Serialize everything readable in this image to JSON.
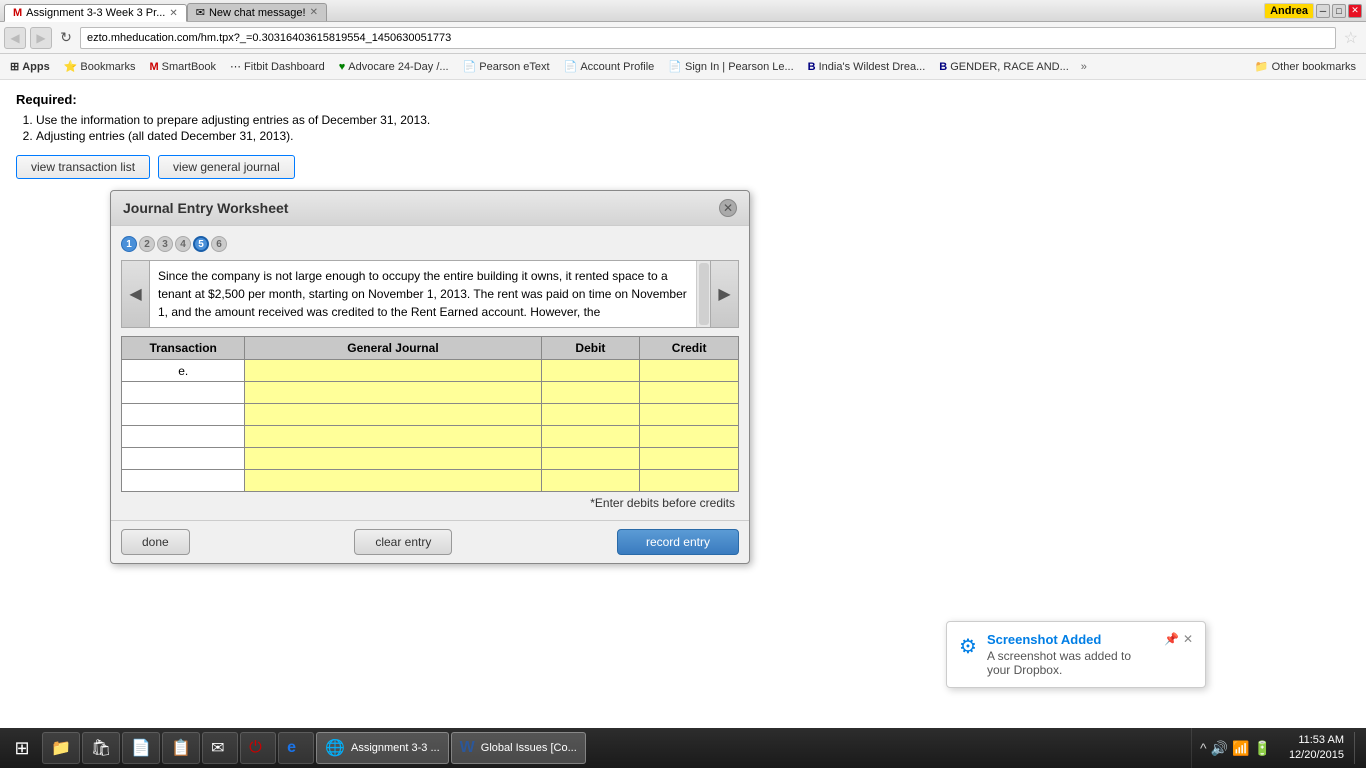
{
  "titlebar": {
    "tabs": [
      {
        "id": "tab1",
        "label": "Assignment 3-3 Week 3 Pr...",
        "favicon": "M",
        "active": true
      },
      {
        "id": "tab2",
        "label": "New chat message!",
        "favicon": "✉",
        "active": false
      }
    ],
    "controls": {
      "minimize": "─",
      "maximize": "□",
      "close": "✕"
    },
    "user": "Andrea"
  },
  "addressbar": {
    "url": "ezto.mheducation.com/hm.tpx?_=0.30316403615819554_1450630051773",
    "back_disabled": true,
    "forward_disabled": true
  },
  "bookmarks": {
    "items": [
      {
        "id": "apps",
        "label": "Apps",
        "type": "apps"
      },
      {
        "id": "bookmarks",
        "label": "Bookmarks",
        "type": "folder"
      },
      {
        "id": "smartbook",
        "label": "SmartBook",
        "type": "link"
      },
      {
        "id": "fitbit",
        "label": "Fitbit Dashboard",
        "type": "link"
      },
      {
        "id": "advocare",
        "label": "Advocare 24-Day /...",
        "type": "link"
      },
      {
        "id": "pearson",
        "label": "Pearson eText",
        "type": "link"
      },
      {
        "id": "account",
        "label": "Account Profile",
        "type": "link"
      },
      {
        "id": "signin",
        "label": "Sign In | Pearson Le...",
        "type": "link"
      },
      {
        "id": "india",
        "label": "India's Wildest Drea...",
        "type": "link"
      },
      {
        "id": "gender",
        "label": "GENDER, RACE AND...",
        "type": "link"
      },
      {
        "id": "more",
        "label": "»",
        "type": "more"
      },
      {
        "id": "otherbookmarks",
        "label": "Other bookmarks",
        "type": "folder"
      }
    ]
  },
  "page": {
    "required_label": "Required:",
    "instruction1": "Use the information to prepare adjusting entries as of December 31, 2013.",
    "instruction2": "Adjusting entries (all dated December 31, 2013).",
    "btn_transaction_list": "view transaction list",
    "btn_general_journal": "view general journal"
  },
  "modal": {
    "title": "Journal Entry Worksheet",
    "close_btn": "✕",
    "steps": [
      {
        "num": "1",
        "active": true
      },
      {
        "num": "2",
        "active": false
      },
      {
        "num": "3",
        "active": false
      },
      {
        "num": "4",
        "active": false
      },
      {
        "num": "5",
        "highlighted": true
      },
      {
        "num": "6",
        "active": false
      }
    ],
    "description": "Since the company is not large enough to occupy the entire building it owns, it rented space to a tenant at $2,500 per month, starting on November 1, 2013. The rent was paid on time on November 1, and the amount received was credited to the Rent Earned account. However, the",
    "table": {
      "headers": [
        "Transaction",
        "General Journal",
        "Debit",
        "Credit"
      ],
      "rows": [
        {
          "transaction": "e.",
          "cells": [
            "",
            "",
            ""
          ]
        },
        {
          "transaction": "",
          "cells": [
            "",
            "",
            ""
          ]
        },
        {
          "transaction": "",
          "cells": [
            "",
            "",
            ""
          ]
        },
        {
          "transaction": "",
          "cells": [
            "",
            "",
            ""
          ]
        },
        {
          "transaction": "",
          "cells": [
            "",
            "",
            ""
          ]
        },
        {
          "transaction": "",
          "cells": [
            "",
            "",
            ""
          ]
        }
      ]
    },
    "enter_note": "*Enter debits before credits",
    "btn_done": "done",
    "btn_clear": "clear entry",
    "btn_record": "record entry"
  },
  "dropbox": {
    "title": "Screenshot Added",
    "message": "A screenshot was added to your Dropbox.",
    "icon": "⚙"
  },
  "taskbar": {
    "start_icon": "⊞",
    "items": [
      {
        "id": "file-explorer",
        "icon": "📁",
        "label": ""
      },
      {
        "id": "store",
        "icon": "🛍",
        "label": ""
      },
      {
        "id": "word-doc",
        "icon": "📄",
        "label": ""
      },
      {
        "id": "task-view",
        "icon": "📋",
        "label": ""
      },
      {
        "id": "email",
        "icon": "✉",
        "label": ""
      },
      {
        "id": "power",
        "icon": "🔴",
        "label": ""
      },
      {
        "id": "ie",
        "icon": "e",
        "label": ""
      },
      {
        "id": "chrome-assignment",
        "icon": "🌐",
        "label": "Assignment 3-3 ..."
      },
      {
        "id": "word-global",
        "icon": "W",
        "label": "Global Issues [Co..."
      }
    ],
    "tray": {
      "icons": [
        "^",
        "🔊",
        "📶",
        "🔋"
      ],
      "time": "11:53 AM",
      "date": "12/20/2015"
    }
  }
}
